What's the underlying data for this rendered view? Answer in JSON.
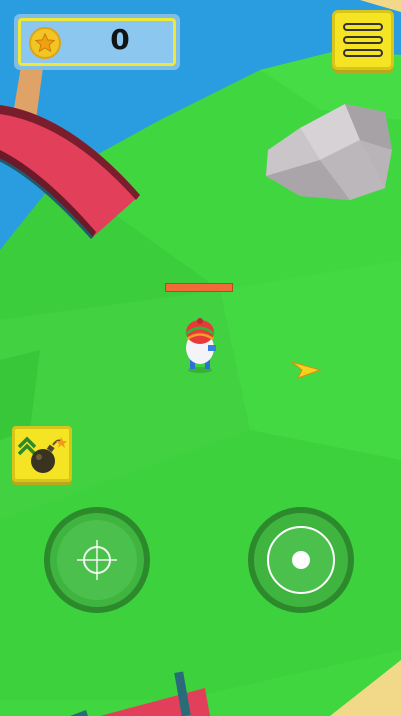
{
  "hud": {
    "score": "0",
    "coin_icon": "star-coin-icon",
    "menu_icon": "hamburger-menu-icon"
  },
  "abilities": {
    "bomb_icon": "bomb-upgrade-icon"
  },
  "player": {
    "health_fraction": 1.0
  },
  "controls": {
    "left_joystick_icon": "crosshair-icon",
    "right_joystick_icon": "fire-dot-icon"
  },
  "colors": {
    "grass": "#3fd43f",
    "water": "#2a9de0",
    "hud_yellow": "#f4e423",
    "health": "#f06a3a"
  }
}
